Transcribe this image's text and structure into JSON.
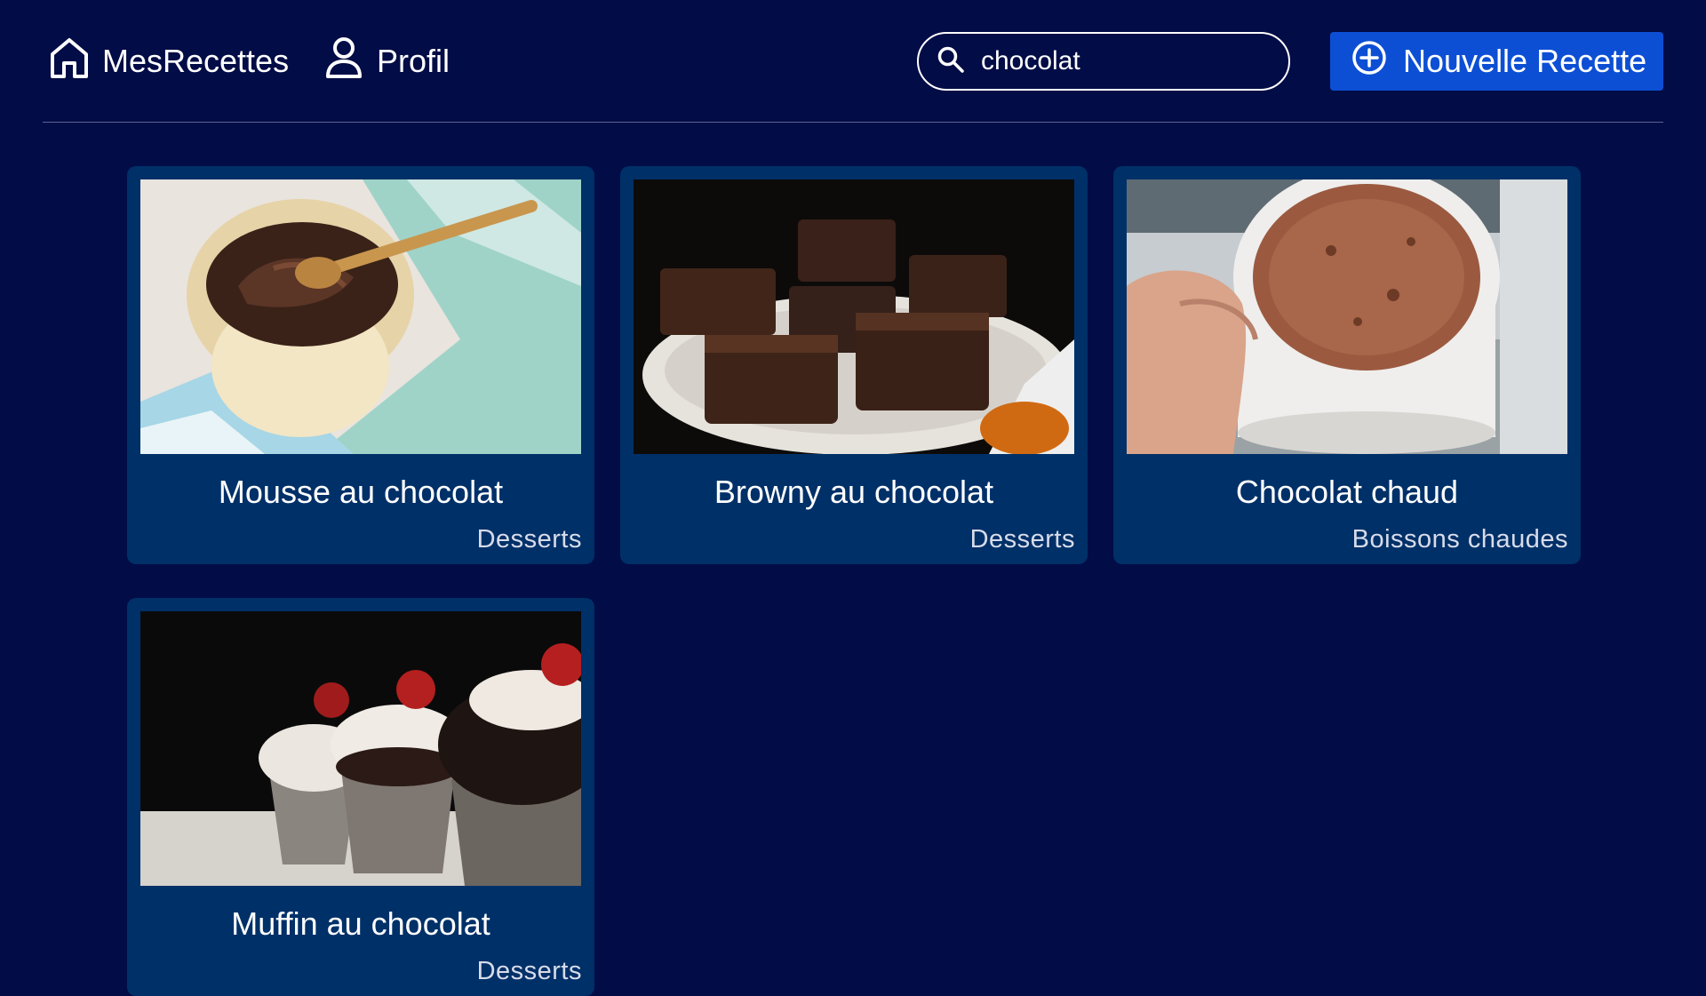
{
  "header": {
    "home_label": "MesRecettes",
    "profile_label": "Profil",
    "search": {
      "value": "chocolat"
    },
    "new_recipe_label": "Nouvelle Recette"
  },
  "recipes": [
    {
      "title": "Mousse au chocolat",
      "category": "Desserts"
    },
    {
      "title": "Browny au chocolat",
      "category": "Desserts"
    },
    {
      "title": "Chocolat chaud",
      "category": "Boissons chaudes"
    },
    {
      "title": "Muffin au chocolat",
      "category": "Desserts"
    }
  ],
  "icons": {
    "home": "home-icon",
    "profile": "person-icon",
    "search": "search-icon",
    "add": "plus-circle-icon"
  },
  "colors": {
    "background": "#020c46",
    "card": "#003068",
    "accent": "#0d4fd4"
  }
}
